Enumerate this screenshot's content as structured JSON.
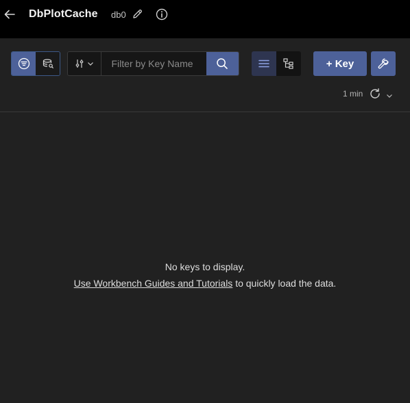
{
  "header": {
    "db_name": "DbPlotCache",
    "db_index": "db0"
  },
  "toolbar": {
    "search": {
      "placeholder": "Filter by Key Name",
      "value": ""
    },
    "add_key_label": "+ Key",
    "refresh": {
      "last_refresh": "1 min"
    }
  },
  "empty_state": {
    "message": "No keys to display.",
    "link_text": "Use Workbench Guides and Tutorials",
    "suffix": " to quickly load the data."
  },
  "colors": {
    "accent": "#4d6199",
    "background": "#212121",
    "header_bg": "#000000"
  }
}
